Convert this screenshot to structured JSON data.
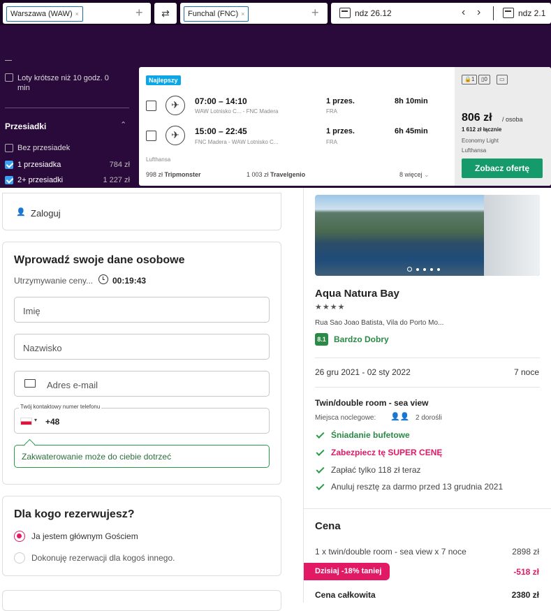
{
  "search": {
    "origin": "Warszawa (WAW)",
    "destination": "Funchal (FNC)",
    "remove_symbol": "×",
    "add_symbol": "+",
    "swap_symbol": "⇄",
    "depart_date": "ndz 26.12",
    "return_date": "ndz 2.1",
    "prev": "‹",
    "next": "›"
  },
  "filters": {
    "short_flights": "Loty krótsze niż 10 godz. 0 min",
    "stops_title": "Przesiadki",
    "stops_chevron": "⌃",
    "options": [
      {
        "label": "Bez przesiadek",
        "checked": false,
        "price": ""
      },
      {
        "label": "1 przesiadka",
        "checked": true,
        "price": "784 zł"
      },
      {
        "label": "2+ przesiadki",
        "checked": true,
        "price": "1 227 zł"
      }
    ]
  },
  "flight_card": {
    "badge": "Najlepszy",
    "legs": [
      {
        "time": "07:00 – 14:10",
        "route": "WAW Lotnisko C... - FNC Madera",
        "stops": "1 przes.",
        "via": "FRA",
        "duration": "8h 10min"
      },
      {
        "time": "15:00 – 22:45",
        "route": "FNC Madera - WAW Lotnisko C...",
        "stops": "1 przes.",
        "via": "FRA",
        "duration": "6h 45min"
      }
    ],
    "airline": "Lufthansa",
    "alt_prices": [
      {
        "price": "998 zł",
        "provider": "Tripmonster"
      },
      {
        "price": "1 003 zł",
        "provider": "Travelgenio"
      }
    ],
    "more": "8 więcej",
    "bags": [
      "1",
      "0",
      ""
    ],
    "price": "806 zł",
    "per_person": "/ osoba",
    "total": "1 612 zł łącznie",
    "fare_class": "Economy Light",
    "carrier": "Lufthansa",
    "cta": "Zobacz ofertę"
  },
  "login": {
    "label": "Zaloguj"
  },
  "personal": {
    "title": "Wprowadź swoje dane osobowe",
    "hold_label": "Utrzymywanie ceny...",
    "timer": "00:19:43",
    "first_name": "Imię",
    "last_name": "Nazwisko",
    "email": "Adres e-mail",
    "phone_label": "Twój kontaktowy numer telefonu",
    "phone_prefix": "+48",
    "tooltip": "Zakwaterowanie może do ciebie dotrzeć"
  },
  "booking_for": {
    "title": "Dla kogo rezerwujesz?",
    "options": [
      {
        "label": "Ja jestem głównym Gościem",
        "selected": true
      },
      {
        "label": "Dokonuję rezerwacji dla kogoś innego.",
        "selected": false
      }
    ]
  },
  "hotel": {
    "name": "Aqua Natura Bay",
    "stars": "★★★★",
    "address": "Rua Sao Joao Batista, Vila do Porto Mo...",
    "score": "8.1",
    "score_label": "Bardzo Dobry",
    "dates": "26 gru 2021 - 02 sty 2022",
    "nights": "7 noce",
    "room": "Twin/double room - sea view",
    "beds_label": "Miejsca noclegowe:",
    "guests": "2 dorośli",
    "features": [
      {
        "text": "Śniadanie bufetowe",
        "style": "green"
      },
      {
        "text": "Zabezpiecz tę SUPER CENĘ",
        "style": "pink"
      },
      {
        "text": "Zapłać tylko 118 zł teraz",
        "style": "plain"
      },
      {
        "text": "Anuluj resztę za darmo przed 13 grudnia 2021",
        "style": "plain"
      }
    ],
    "gallery_dots": 5,
    "gallery_active": 0
  },
  "price": {
    "title": "Cena",
    "line_label": "1 x twin/double room - sea view x 7 noce",
    "line_value": "2898 zł",
    "discount_label": "Dzisiaj -18% taniej",
    "discount_value": "-518 zł",
    "total_label": "Cena całkowita",
    "total_value": "2380 zł"
  },
  "colors": {
    "accent_pink": "#e21a66",
    "green": "#159a6b",
    "dark_purple": "#2a0a3a"
  }
}
